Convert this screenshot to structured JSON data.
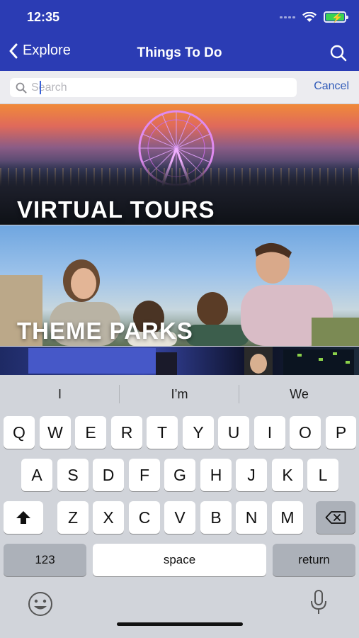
{
  "status": {
    "time": "12:35"
  },
  "nav": {
    "back_label": "Explore",
    "title": "Things To Do"
  },
  "search": {
    "placeholder": "Search",
    "cancel_label": "Cancel"
  },
  "cards": [
    {
      "title": "VIRTUAL TOURS"
    },
    {
      "title": "THEME PARKS"
    }
  ],
  "keyboard": {
    "suggestions": [
      "I",
      "I’m",
      "We"
    ],
    "row1": [
      "Q",
      "W",
      "E",
      "R",
      "T",
      "Y",
      "U",
      "I",
      "O",
      "P"
    ],
    "row2": [
      "A",
      "S",
      "D",
      "F",
      "G",
      "H",
      "J",
      "K",
      "L"
    ],
    "row3": [
      "Z",
      "X",
      "C",
      "V",
      "B",
      "N",
      "M"
    ],
    "numbers_label": "123",
    "space_label": "space",
    "return_label": "return"
  },
  "colors": {
    "header_bg": "#2b3cb4",
    "accent": "#2f5ab8",
    "battery": "#39d353"
  },
  "icons": [
    "chevron-left-icon",
    "search-icon",
    "wifi-icon",
    "battery-icon",
    "shift-icon",
    "backspace-icon",
    "emoji-icon",
    "microphone-icon"
  ]
}
